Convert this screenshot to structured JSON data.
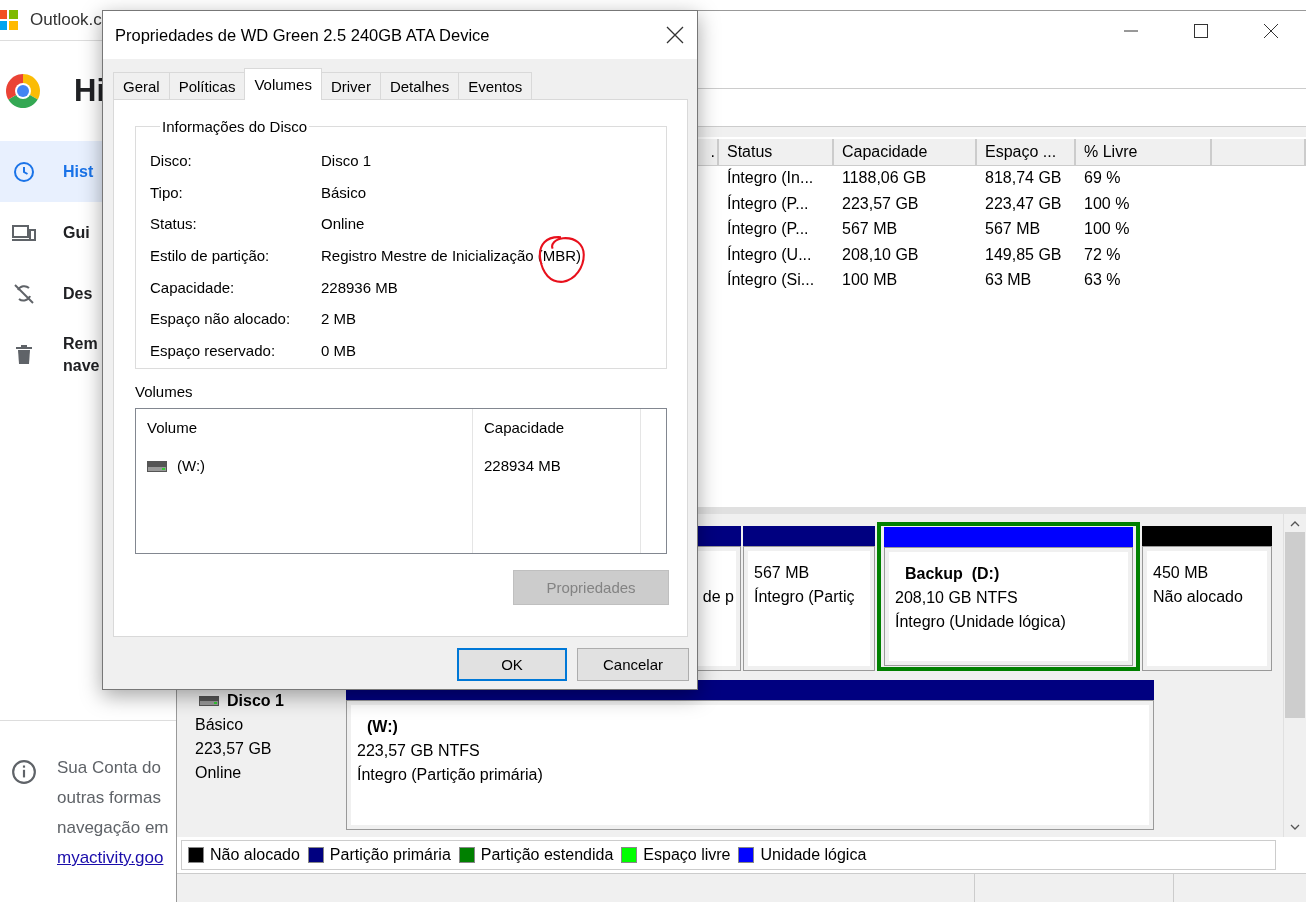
{
  "browser": {
    "tab_title": "Outlook.c",
    "page_title": "Hi",
    "nav": [
      {
        "lines": [
          "Hist"
        ],
        "selected": true
      },
      {
        "lines": [
          "Gui"
        ],
        "selected": false
      },
      {
        "lines": [
          "Des"
        ],
        "selected": false
      },
      {
        "lines": [
          "Rem",
          "nave"
        ],
        "selected": false
      }
    ],
    "footer": {
      "lines": [
        "Sua Conta do",
        "outras formas",
        "navegação em"
      ],
      "link": "myactivity.goo"
    }
  },
  "disk_management": {
    "volume_table": {
      "columns": [
        ".",
        "Status",
        "Capacidade",
        "Espaço ...",
        "% Livre"
      ],
      "rows": [
        [
          "",
          "Íntegro (In...",
          "1188,06 GB",
          "818,74 GB",
          "69 %"
        ],
        [
          "",
          "Íntegro (P...",
          "223,57 GB",
          "223,47 GB",
          "100 %"
        ],
        [
          "",
          "Íntegro (P...",
          "567 MB",
          "567 MB",
          "100 %"
        ],
        [
          "",
          "Íntegro (U...",
          "208,10 GB",
          "149,85 GB",
          "72 %"
        ],
        [
          "",
          "Íntegro (Si...",
          "100 MB",
          "63 MB",
          "63 %"
        ]
      ]
    },
    "disks": [
      {
        "partitions": [
          {
            "color": "#000080",
            "extended": false,
            "lines": [
              "de p"
            ]
          },
          {
            "color": "#000080",
            "extended": false,
            "lines": [
              "567 MB",
              "Íntegro (Partiç"
            ]
          },
          {
            "color": "#0000ff",
            "extended": true,
            "title": "Backup  (D:)",
            "lines": [
              "208,10 GB NTFS",
              "Íntegro (Unidade lógica)"
            ]
          },
          {
            "color": "#000000",
            "extended": false,
            "lines": [
              "450 MB",
              "Não alocado"
            ]
          }
        ]
      },
      {
        "name": "Disco 1",
        "info": [
          "Básico",
          "223,57 GB",
          "Online"
        ],
        "partitions": [
          {
            "color": "#000080",
            "extended": false,
            "title": "(W:)",
            "lines": [
              "223,57 GB NTFS",
              "Íntegro (Partição primária)"
            ]
          }
        ]
      }
    ],
    "legend": [
      {
        "label": "Não alocado",
        "color": "#000000"
      },
      {
        "label": "Partição primária",
        "color": "#000080"
      },
      {
        "label": "Partição estendida",
        "color": "#008000"
      },
      {
        "label": "Espaço livre",
        "color": "#00ff00"
      },
      {
        "label": "Unidade lógica",
        "color": "#0000ff"
      }
    ]
  },
  "dialog": {
    "title": "Propriedades de WD Green 2.5 240GB ATA Device",
    "tabs": [
      {
        "label": "Geral",
        "selected": false
      },
      {
        "label": "Políticas",
        "selected": false
      },
      {
        "label": "Volumes",
        "selected": true
      },
      {
        "label": "Driver",
        "selected": false
      },
      {
        "label": "Detalhes",
        "selected": false
      },
      {
        "label": "Eventos",
        "selected": false
      }
    ],
    "group_title": "Informações do Disco",
    "info": [
      {
        "label": "Disco:",
        "value": "Disco 1",
        "circled": false
      },
      {
        "label": "Tipo:",
        "value": "Básico",
        "circled": false
      },
      {
        "label": "Status:",
        "value": "Online",
        "circled": false
      },
      {
        "label": "Estilo de partição:",
        "value": "Registro Mestre de Inicialização (MBR)",
        "circled": true
      },
      {
        "label": "Capacidade:",
        "value": "228936 MB",
        "circled": false
      },
      {
        "label": "Espaço não alocado:",
        "value": "2 MB",
        "circled": false
      },
      {
        "label": "Espaço reservado:",
        "value": "0 MB",
        "circled": false
      }
    ],
    "volumes_label": "Volumes",
    "volumes": {
      "columns": [
        "Volume",
        "Capacidade"
      ],
      "rows": [
        [
          "(W:)",
          "228934 MB"
        ]
      ]
    },
    "properties_button": {
      "label": "Propriedades",
      "disabled": true
    },
    "buttons": [
      {
        "label": "OK",
        "default": true
      },
      {
        "label": "Cancelar",
        "default": false
      }
    ]
  }
}
